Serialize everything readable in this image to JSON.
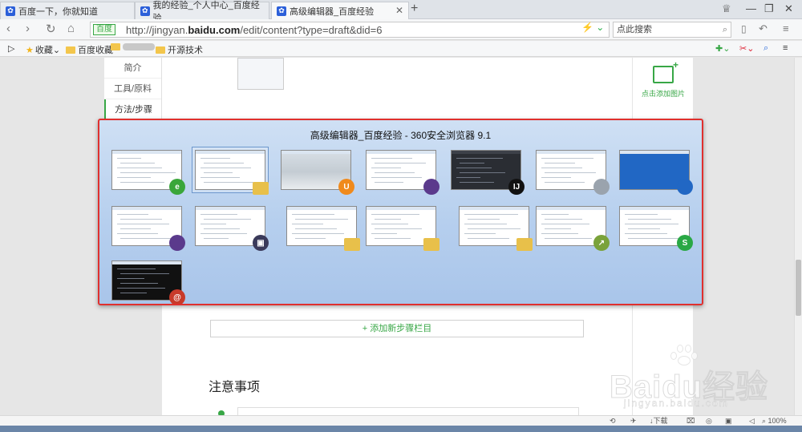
{
  "tabs": [
    {
      "label": "百度一下，你就知道"
    },
    {
      "label": "我的经验_个人中心_百度经验"
    },
    {
      "label": "高级编辑器_百度经验"
    }
  ],
  "address": {
    "badge": "百度",
    "url_prefix": "http://jingyan.",
    "url_domain": "baidu.com",
    "url_path": "/edit/content?type=draft&did=6",
    "search_placeholder": "点此搜索"
  },
  "bookmarks": [
    {
      "label": "收藏"
    },
    {
      "label": "百度收藏"
    },
    {
      "label": "开源技术"
    }
  ],
  "sidebar": {
    "items": [
      {
        "label": "简介"
      },
      {
        "label": "工具/原料"
      },
      {
        "label": "方法/步骤"
      }
    ]
  },
  "editor": {
    "add_image_label": "点击添加图片",
    "add_step_label": "+ 添加新步骤栏目",
    "notes_heading": "注意事项"
  },
  "switcher": {
    "title": "高级编辑器_百度经验 - 360安全浏览器 9.1",
    "windows": [
      {
        "app": "ie-icon"
      },
      {
        "app": "folder-icon"
      },
      {
        "app": "uc-browser-icon"
      },
      {
        "app": "eclipse-icon"
      },
      {
        "app": "intellij-icon"
      },
      {
        "app": "database-icon"
      },
      {
        "app": "desktop-icon"
      },
      {
        "app": "eclipse-icon"
      },
      {
        "app": "virtualbox-icon"
      },
      {
        "app": "folder-icon"
      },
      {
        "app": "folder-icon"
      },
      {
        "app": "folder-icon"
      },
      {
        "app": "chart-app-icon"
      },
      {
        "app": "spreadsheet-icon"
      },
      {
        "app": "terminal-app-icon"
      }
    ]
  },
  "statusbar": {
    "download": "下载",
    "zoom": "100%"
  },
  "watermark": {
    "brand": "Baidu经验",
    "url": "jingyan.baidu.com"
  },
  "colors": {
    "accent_green": "#38a746",
    "switcher_border": "#e0302e",
    "tab_icon_blue": "#2b5fd9"
  }
}
